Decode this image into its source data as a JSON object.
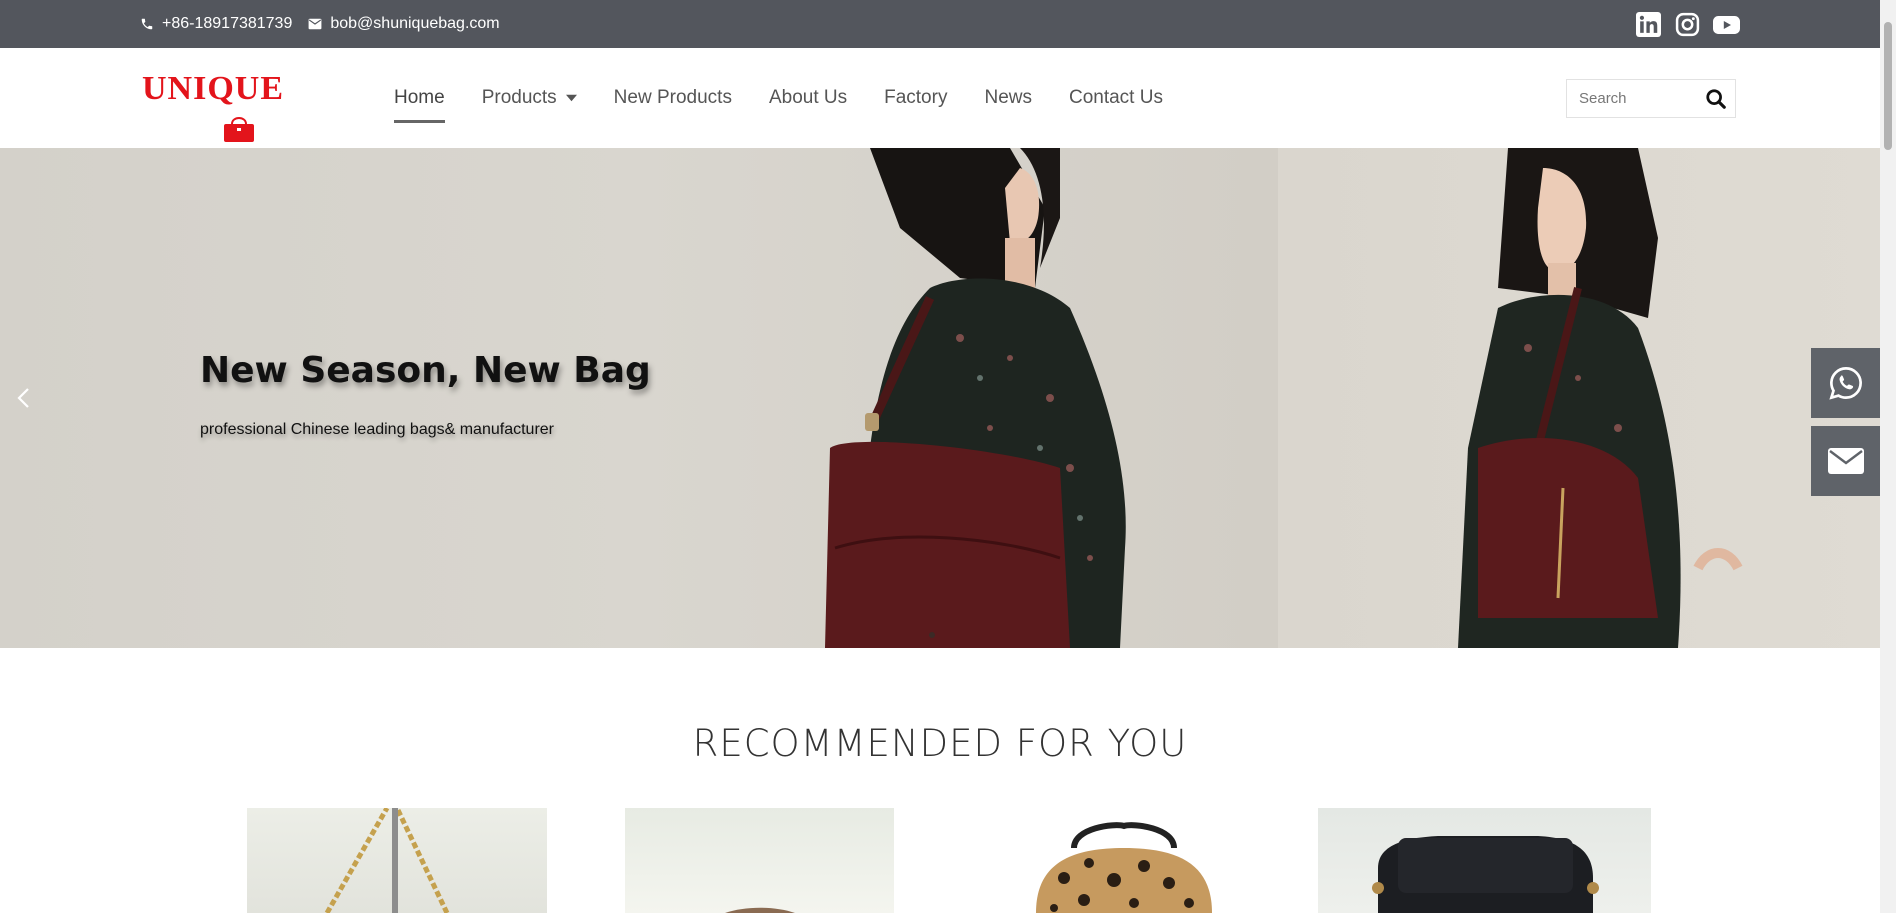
{
  "topbar": {
    "phone": "+86-18917381739",
    "email": "bob@shuniquebag.com",
    "social": [
      "linkedin-icon",
      "instagram-icon",
      "youtube-icon"
    ]
  },
  "logo": {
    "text": "UNIQUE",
    "color": "#e3141b"
  },
  "nav": {
    "home": "Home",
    "products": "Products",
    "new_products": "New Products",
    "about": "About Us",
    "factory": "Factory",
    "news": "News",
    "contact": "Contact Us"
  },
  "search": {
    "placeholder": "Search"
  },
  "hero": {
    "title": "New Season, New Bag",
    "subtitle": "professional Chinese leading bags& manufacturer"
  },
  "floating": [
    "whatsapp-icon",
    "email-icon"
  ],
  "recommended": {
    "title": "RECOMMENDED FOR YOU"
  },
  "colors": {
    "topbar": "#53565d",
    "accent": "#e3141b",
    "bag": "#5a1a1c"
  }
}
